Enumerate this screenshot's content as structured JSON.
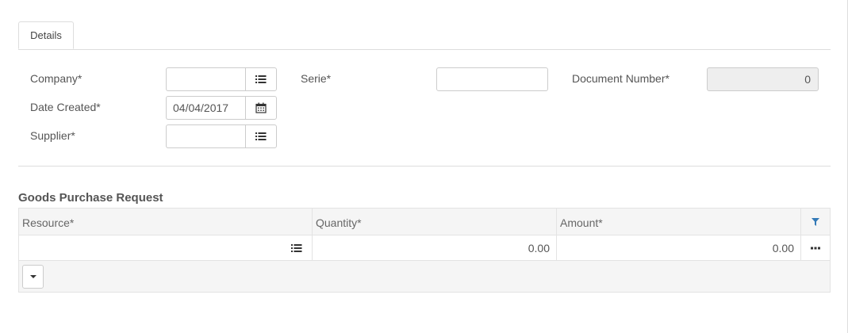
{
  "tabs": [
    {
      "label": "Details"
    }
  ],
  "form": {
    "company": {
      "label": "Company*",
      "value": "",
      "icon": "list-icon"
    },
    "serie": {
      "label": "Serie*",
      "value": ""
    },
    "document_number": {
      "label": "Document Number*",
      "value": "0"
    },
    "date_created": {
      "label": "Date Created*",
      "value": "04/04/2017",
      "icon": "calendar-icon"
    },
    "supplier": {
      "label": "Supplier*",
      "value": "",
      "icon": "list-icon"
    }
  },
  "section": {
    "title": "Goods Purchase Request"
  },
  "grid": {
    "columns": [
      "Resource*",
      "Quantity*",
      "Amount*"
    ],
    "rows": [
      {
        "resource": "",
        "quantity": "0.00",
        "amount": "0.00"
      }
    ]
  },
  "colors": {
    "accent": "#337ab7",
    "border": "#dddddd",
    "disabled_bg": "#eeeeee"
  }
}
